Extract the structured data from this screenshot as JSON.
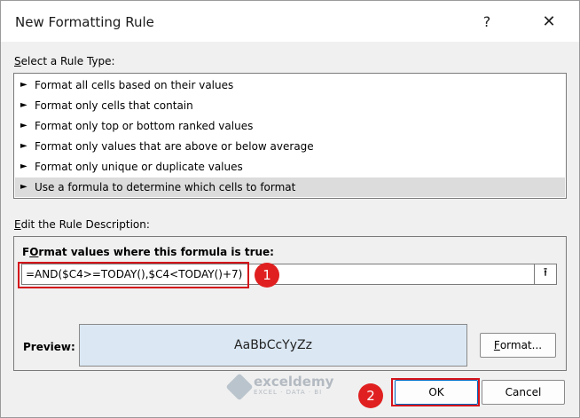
{
  "dialog": {
    "title": "New Formatting Rule",
    "help_label": "?",
    "close_label": "✕"
  },
  "rule_type": {
    "label_accel": "S",
    "label_rest": "elect a Rule Type:",
    "items": [
      {
        "label": "Format all cells based on their values",
        "selected": false
      },
      {
        "label": "Format only cells that contain",
        "selected": false
      },
      {
        "label": "Format only top or bottom ranked values",
        "selected": false
      },
      {
        "label": "Format only values that are above or below average",
        "selected": false
      },
      {
        "label": "Format only unique or duplicate values",
        "selected": false
      },
      {
        "label": "Use a formula to determine which cells to format",
        "selected": true
      }
    ],
    "bullet": "►"
  },
  "description": {
    "label_accel": "E",
    "label_rest": "dit the Rule Description:",
    "formula_label_accel": "O",
    "formula_label_pre": "F",
    "formula_label_rest": "rmat values where this formula is true:",
    "formula_value": "=AND($C4>=TODAY(),$C4<TODAY()+7)",
    "collapse_icon": "⭱",
    "preview_label": "Preview:",
    "preview_sample": "AaBbCcYyZz",
    "format_button_accel": "F",
    "format_button_rest": "ormat..."
  },
  "buttons": {
    "ok": "OK",
    "cancel": "Cancel"
  },
  "annotations": {
    "marker_1": "1",
    "marker_2": "2"
  },
  "watermark": {
    "name": "exceldemy",
    "tagline": "EXCEL · DATA · BI"
  },
  "colors": {
    "highlight": "#d4141b",
    "marker": "#e02020",
    "preview_fill": "#dbe8f4",
    "selected_row": "#dcdcdc"
  }
}
